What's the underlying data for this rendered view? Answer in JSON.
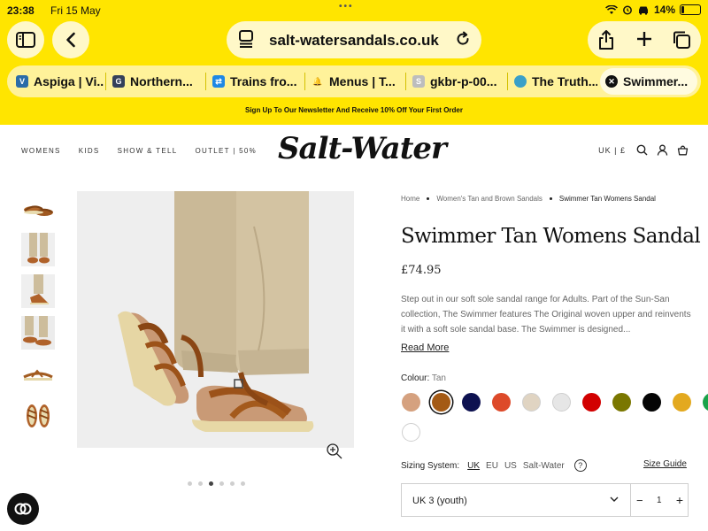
{
  "status_bar": {
    "time": "23:38",
    "date": "Fri 15 May",
    "battery": "14%",
    "battery_fraction": 0.14
  },
  "browser": {
    "url": "salt-watersandals.co.uk",
    "tabs": [
      {
        "title": "Aspiga | Vi...",
        "icon": "aspiga-favicon",
        "color": "#2b6ca8",
        "glyph": "V"
      },
      {
        "title": "Northern...",
        "icon": "northern-favicon",
        "color": "#34405a",
        "glyph": "G"
      },
      {
        "title": "Trains fro...",
        "icon": "trains-favicon",
        "color": "#1e88e5",
        "glyph": "⇄"
      },
      {
        "title": "Menus | T...",
        "icon": "bell-favicon",
        "color": "#7a6200",
        "glyph": "🔔"
      },
      {
        "title": "gkbr-p-00...",
        "icon": "gkbr-favicon",
        "color": "#bdbdbd",
        "glyph": "S"
      },
      {
        "title": "The Truth...",
        "icon": "truth-favicon",
        "color": "#3aa0c8",
        "glyph": ""
      },
      {
        "title": "Swimmer...",
        "icon": "close-tab-icon",
        "color": "#111111",
        "glyph": "✕",
        "active": true
      }
    ]
  },
  "newsletter": "Sign Up To Our Newsletter And Receive 10% Off Your First Order",
  "site": {
    "nav": [
      "WOMENS",
      "KIDS",
      "SHOW & TELL",
      "OUTLET | 50%"
    ],
    "logo": "Salt-Water",
    "currency": "UK | £"
  },
  "product": {
    "breadcrumb": [
      "Home",
      "Women's Tan and Brown Sandals",
      "Swimmer Tan Womens Sandal"
    ],
    "title": "Swimmer Tan Womens Sandal",
    "price": "£74.95",
    "description": "Step out in our soft sole sandal range for Adults. Part of the Sun-San collection, The Swimmer features The Original woven upper and reinvents it with a soft sole sandal base. The Swimmer is designed...",
    "read_more": "Read More",
    "colour_label": "Colour:",
    "colour_value": "Tan",
    "swatches": [
      "#d5a17f",
      "#a45a15",
      "#0d1150",
      "#dd4a2a",
      "#e0d4c2",
      "#e6e6e6",
      "#d20000",
      "#7a7700",
      "#050505",
      "#e3a91f",
      "#1aa34a",
      "#ffffff"
    ],
    "selected_swatch": 1,
    "sizing_label": "Sizing System:",
    "sizing_options": [
      "UK",
      "EU",
      "US",
      "Salt-Water"
    ],
    "sizing_active": "UK",
    "help_glyph": "?",
    "size_guide": "Size Guide",
    "size_value": "UK 3 (youth)",
    "qty_minus": "−",
    "quantity": "1",
    "qty_plus": "+",
    "carousel_count": 6,
    "carousel_active": 2
  }
}
